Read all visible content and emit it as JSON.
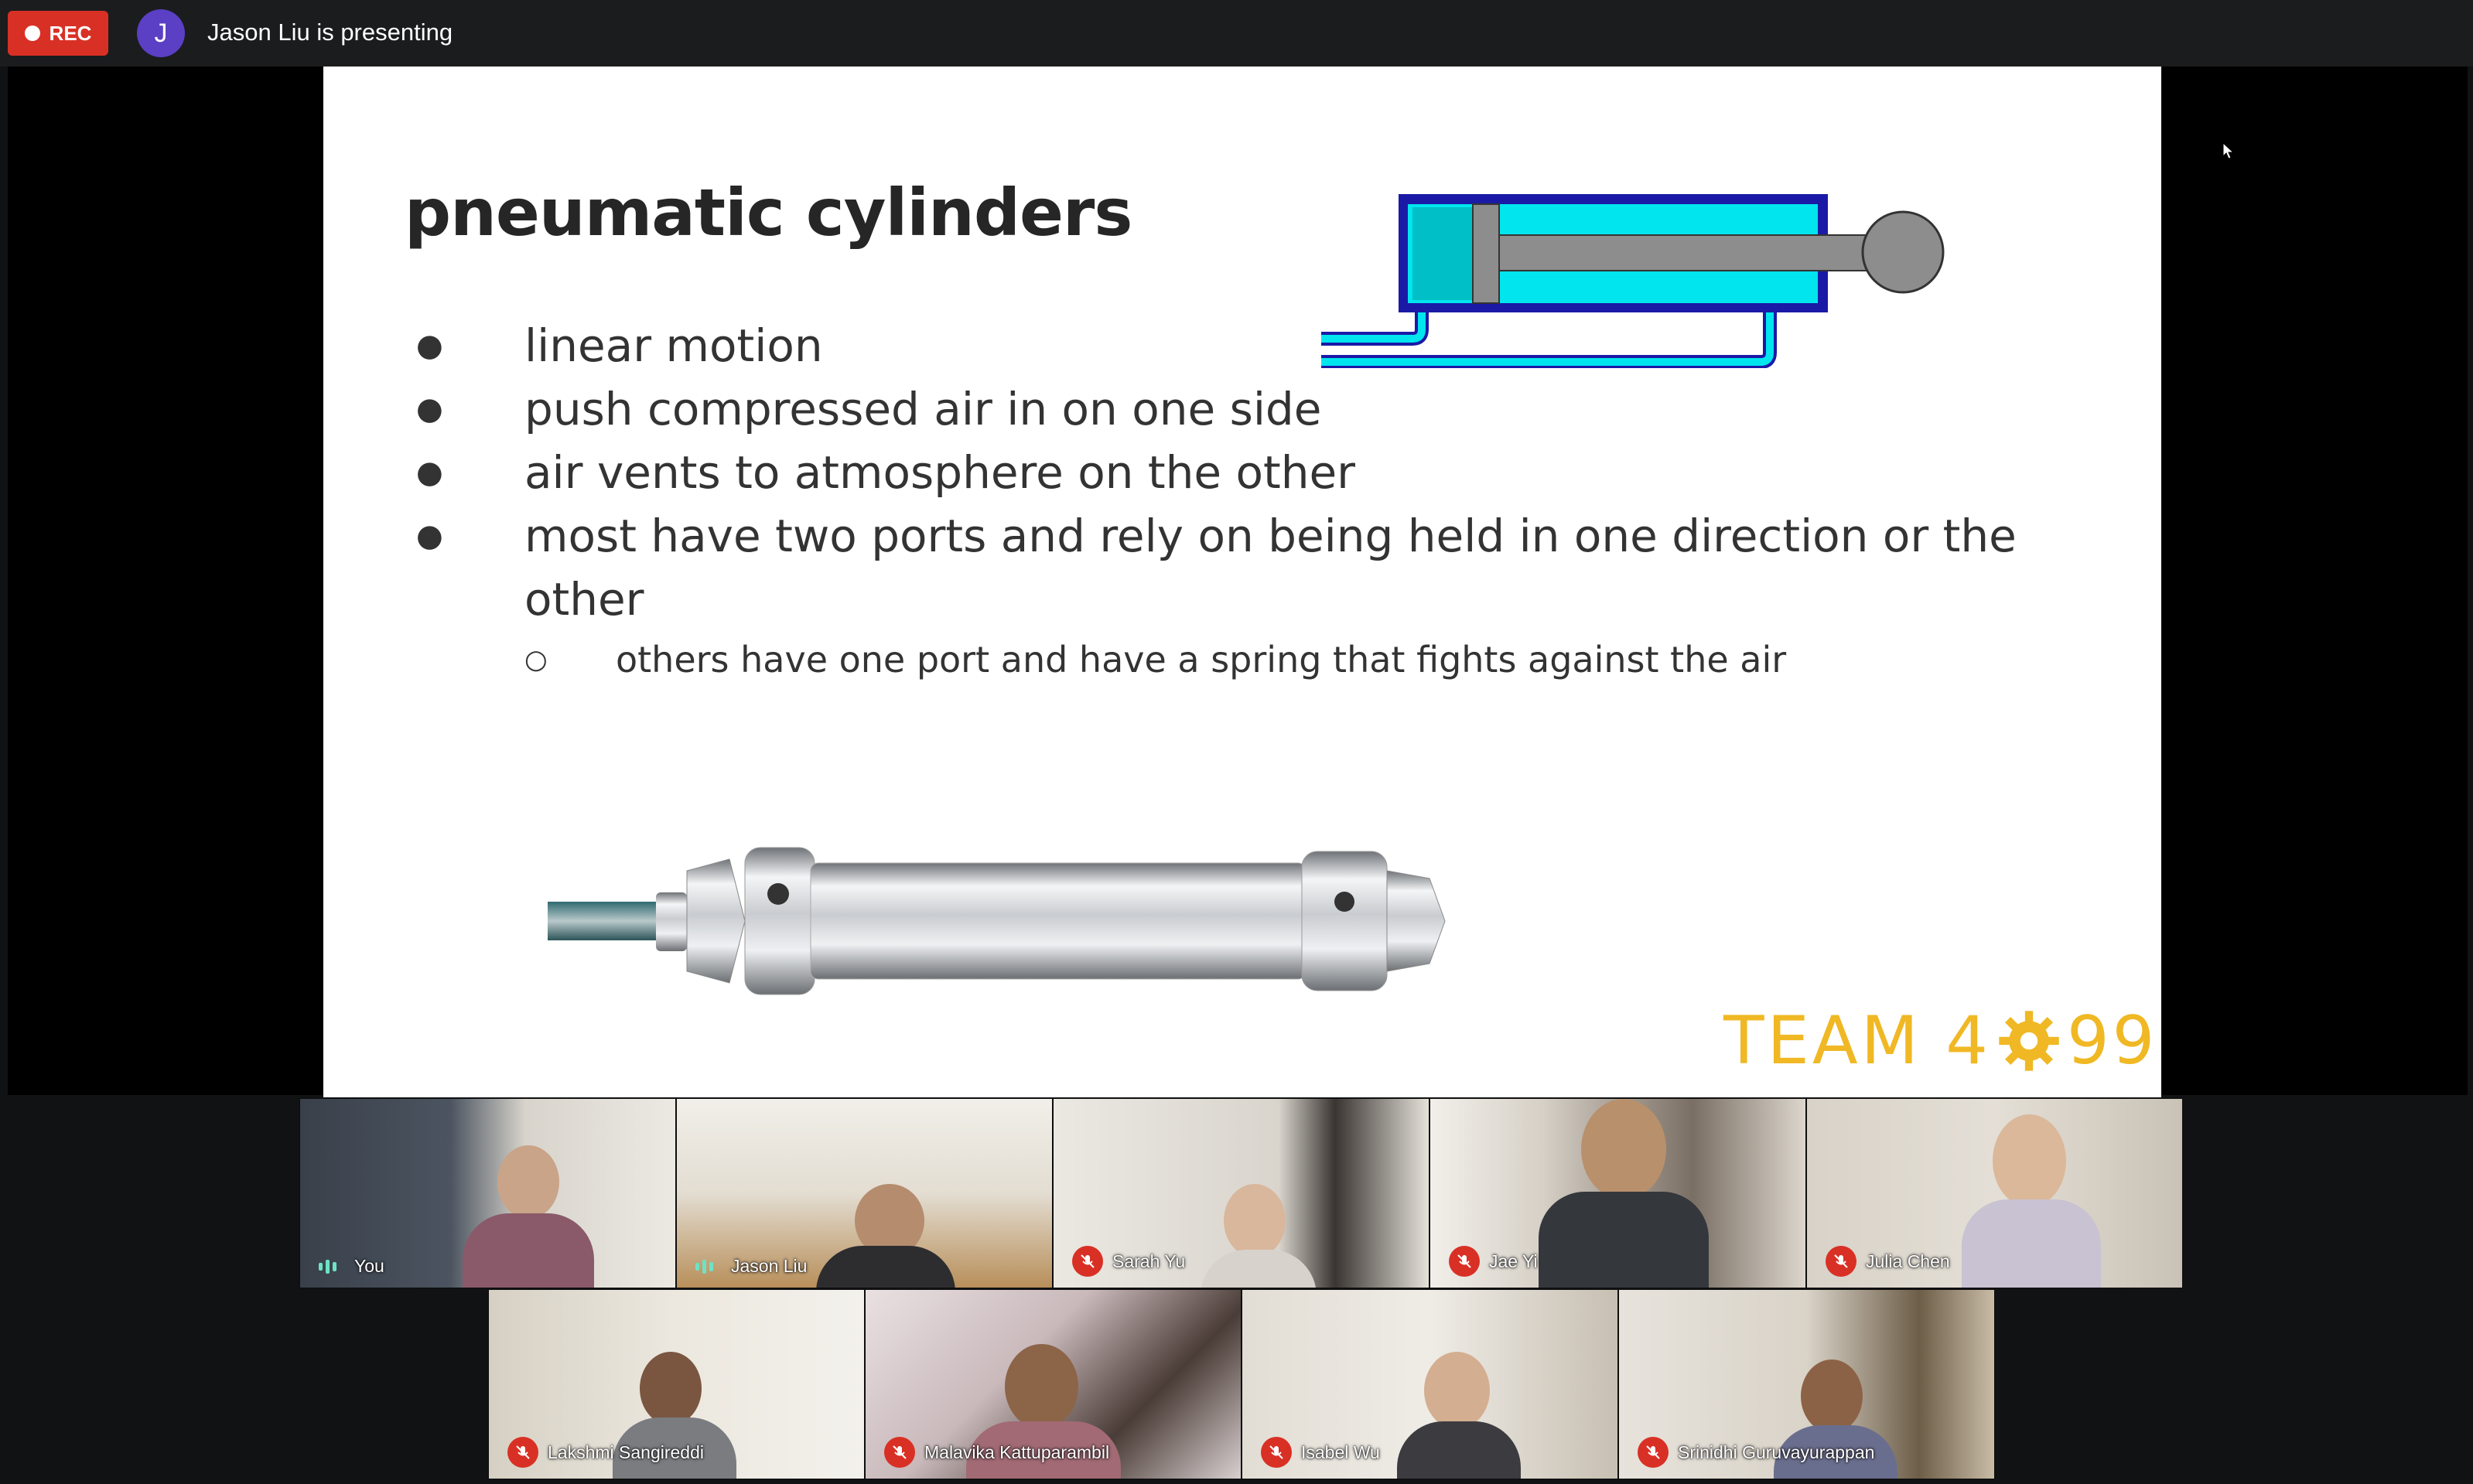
{
  "topbar": {
    "rec_label": "REC",
    "presenter_initial": "J",
    "presenter_text": "Jason Liu is presenting"
  },
  "slide": {
    "title": "pneumatic cylinders",
    "bullets": [
      "linear motion",
      "push compressed air in on one side",
      "air vents to atmosphere on the other",
      "most have two ports and rely on being held in one direction or the other"
    ],
    "sub_bullets": [
      "others have one port and have a spring that fights against the air"
    ],
    "logo_prefix": "TEAM 4",
    "logo_suffix": "99",
    "logo_color": "#f0b824"
  },
  "participants": {
    "row1": [
      {
        "name": "You",
        "muted": false
      },
      {
        "name": "Jason Liu",
        "muted": false
      },
      {
        "name": "Sarah Yu",
        "muted": true
      },
      {
        "name": "Jae Yi",
        "muted": true
      },
      {
        "name": "Julia Chen",
        "muted": true
      }
    ],
    "row2": [
      {
        "name": "Lakshmi Sangireddi",
        "muted": true
      },
      {
        "name": "Malavika Kattuparambil",
        "muted": true
      },
      {
        "name": "Isabel Wu",
        "muted": true
      },
      {
        "name": "Srinidhi Guruvayurappan",
        "muted": true
      }
    ]
  },
  "icons": {
    "muted_mic": "mic-off-icon",
    "active_mic": "audio-level-icon",
    "recording": "record-dot-icon",
    "cursor": "mouse-pointer-icon"
  },
  "colors": {
    "rec_red": "#d93025",
    "avatar_purple": "#5b3fc4",
    "diagram_cyan": "#00e5ee",
    "diagram_blue": "#1a1aa6"
  }
}
